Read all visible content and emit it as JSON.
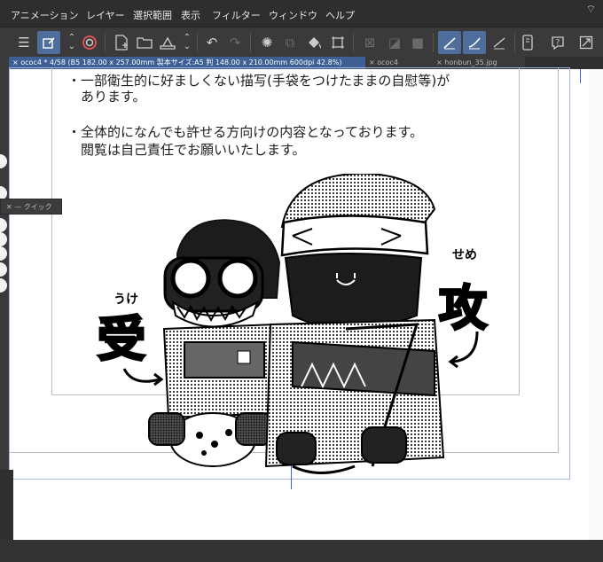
{
  "menubar": {
    "items": [
      "アニメーション",
      "レイヤー",
      "選択範囲",
      "表示",
      "フィルター",
      "ウィンドウ",
      "ヘルプ"
    ]
  },
  "toolbar": {
    "icons": [
      "menu-icon",
      "edit-icon",
      "chevron-updown-icon",
      "circle-icon",
      "new-page-icon",
      "open-folder-icon",
      "save-icon",
      "chevron-updown-icon",
      "undo-icon",
      "redo-icon",
      "loading-icon",
      "copy-icon",
      "fill-icon",
      "transform-icon",
      "clear-selection-icon",
      "crop-icon",
      "fill-area-icon",
      "pen-icon",
      "smooth-pen-icon",
      "ruler-icon",
      "device-icon",
      "help-icon",
      "expand-icon"
    ]
  },
  "tabs": [
    {
      "label": "ococ4 * 4/58 (B5 182.00 x 257.00mm 製本サイズ:A5 判 148.00 x 210.00mm 600dpi 42.8%)",
      "state": "active"
    },
    {
      "label": "ococ4",
      "state": "inactive"
    },
    {
      "label": "honbun_35.jpg",
      "state": "inactive"
    }
  ],
  "quick_panel": {
    "label": "クイック"
  },
  "canvas": {
    "lines": [
      "・一部衛生的に好ましくない描写(手袋をつけたままの自慰等)が",
      "　あります。",
      "・全体的になんでも許せる方向けの内容となっております。",
      "　閲覧は自己責任でお願いいたします。"
    ],
    "illustration": {
      "left_label_reading": "うけ",
      "left_label_kanji": "受",
      "right_label_reading": "せめ",
      "right_label_kanji": "攻"
    }
  },
  "colors": {
    "accent": "#4f6e9c",
    "tab_active": "#3d5f94",
    "guide": "#9aa9d8",
    "guide_blue": "#4a5fcf"
  }
}
